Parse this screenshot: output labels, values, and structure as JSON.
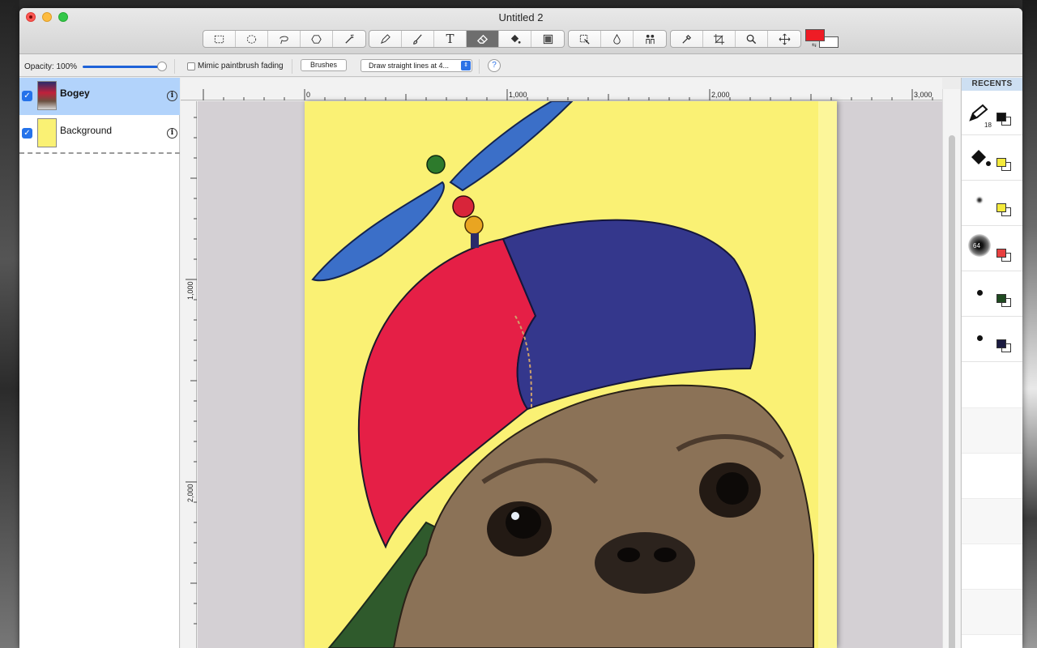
{
  "window": {
    "title": "Untitled 2"
  },
  "toolbar": {
    "groups": [
      [
        "rect-select",
        "ellipse-select",
        "lasso-select",
        "polygon-select",
        "magic-wand"
      ],
      [
        "pencil",
        "paintbrush",
        "text",
        "eraser",
        "paint-bucket",
        "gradient"
      ],
      [
        "instant-alpha",
        "blur",
        "clone"
      ],
      [
        "eyedropper",
        "crop",
        "zoom",
        "move"
      ]
    ],
    "text_tool_glyph": "T",
    "active_tool": "eraser",
    "foreground_color": "#ee1c25",
    "background_color": "#ffffff"
  },
  "options": {
    "opacity_label": "Opacity: 100%",
    "opacity": 1.0,
    "mimic_label": "Mimic paintbrush fading",
    "mimic_checked": false,
    "brushes_label": "Brushes",
    "line_mode_label": "Draw straight lines at 4...",
    "help_label": "?"
  },
  "layers": [
    {
      "name": "Bogey",
      "visible": true,
      "selected": true
    },
    {
      "name": "Background",
      "visible": true,
      "selected": false
    }
  ],
  "rulers": {
    "horizontal": [
      "0",
      "1,000",
      "2,000",
      "3,000"
    ],
    "vertical": [
      "1,000",
      "2,000"
    ]
  },
  "recents": {
    "title": "RECENTS",
    "items": [
      {
        "tool": "pencil",
        "size": "18",
        "color": "#111111"
      },
      {
        "tool": "paint-bucket",
        "size": "",
        "color": "#f4ea3c"
      },
      {
        "tool": "brush-small",
        "size": "",
        "color": "#f4ea3c"
      },
      {
        "tool": "brush-soft",
        "size": "64",
        "color": "#e84040"
      },
      {
        "tool": "brush-dot",
        "size": "",
        "color": "#1f4a20"
      },
      {
        "tool": "brush-dot",
        "size": "",
        "color": "#1a1a40"
      }
    ]
  },
  "colors": {
    "canvas_fill": "#faf174",
    "selection": "#b2d3fb",
    "accent": "#2472ea"
  }
}
